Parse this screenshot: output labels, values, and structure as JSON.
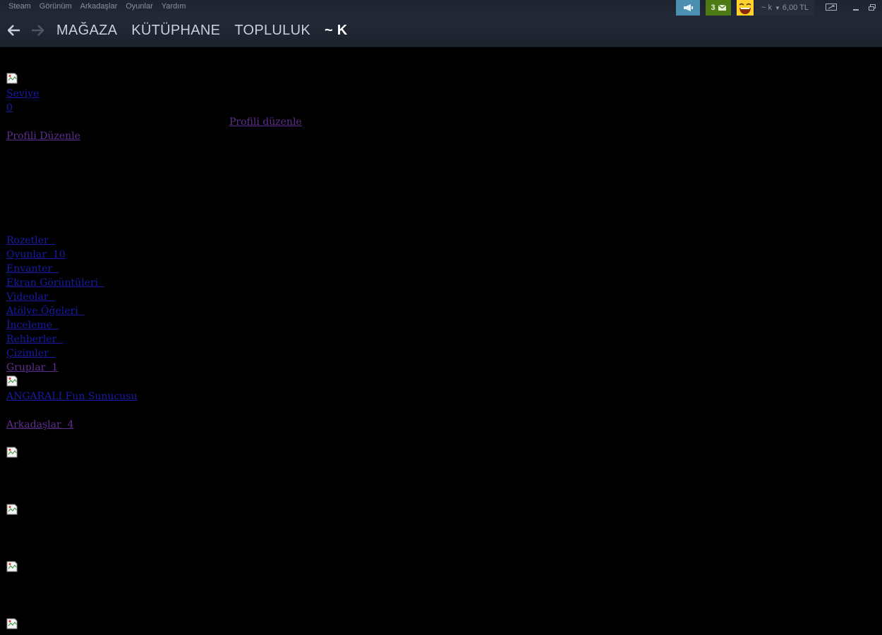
{
  "menu": [
    "Steam",
    "Görünüm",
    "Arkadaşlar",
    "Oyunlar",
    "Yardım"
  ],
  "nav": {
    "tabs": [
      "MAĞAZA",
      "KÜTÜPHANE",
      "TOPLULUK",
      "~ K"
    ]
  },
  "header_right": {
    "notification_count": "3",
    "account_name": "~ k",
    "wallet": "6,00 TL"
  },
  "profile": {
    "level_label": "Seviye",
    "level_value": "0",
    "edit_profile_lower": "Profili düzenle",
    "edit_profile": "Profili Düzenle"
  },
  "sidebar_links": [
    "Rozetler  ",
    "Oyunlar  10",
    "Envanter  ",
    "Ekran Görüntüleri  ",
    "Videolar  ",
    "Atölye Öğeleri  ",
    "İnceleme  ",
    "Rehberler  ",
    "Çizimler  ",
    "Gruplar  1"
  ],
  "group": {
    "name": "ANGARALI Fun Sunucusu"
  },
  "friends": {
    "label": "Arkadaşlar  4"
  },
  "colors": {
    "link": "#1a1aa6",
    "visited_link": "#5e2f8e",
    "announce_bg": "#4c8fb1",
    "notif_bg": "#4d7a15",
    "emoticon_bg": "#ffd22e",
    "chrome_bg": "#232937"
  },
  "icons": {
    "back": "left-arrow-icon",
    "forward": "right-arrow-icon",
    "announce": "megaphone-icon",
    "notifications": "envelope-icon",
    "avatar": "laughing-emoticon-icon",
    "big_picture": "big-picture-icon",
    "broken_image": "broken-image-icon"
  }
}
